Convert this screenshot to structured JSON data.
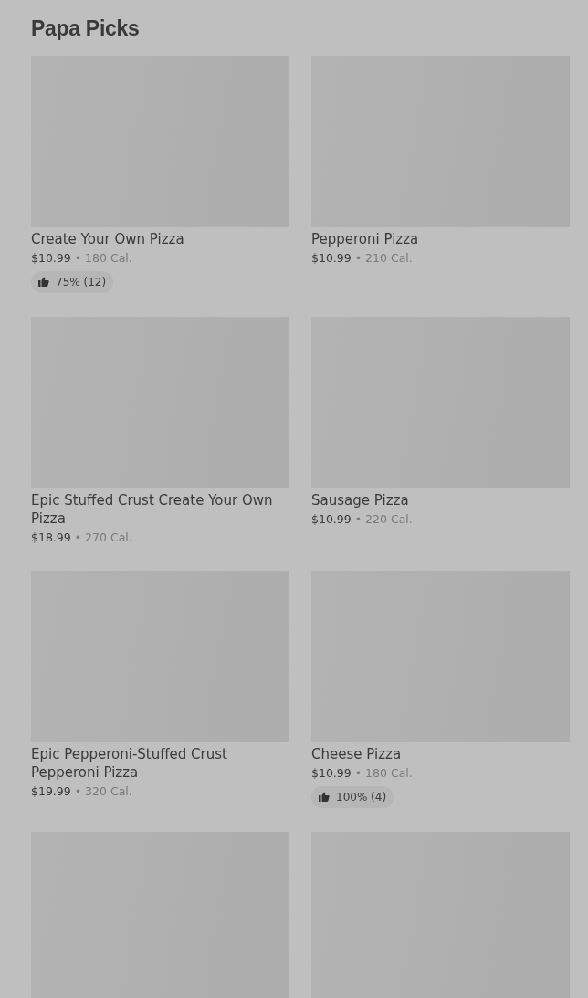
{
  "section": {
    "title": "Papa Picks"
  },
  "items": [
    {
      "kind": "product",
      "name": "Create Your Own Pizza",
      "price": "$10.99",
      "separator": "•",
      "calories": "180 Cal.",
      "rating": "75% (12)"
    },
    {
      "kind": "product",
      "name": "Pepperoni Pizza",
      "price": "$10.99",
      "separator": "•",
      "calories": "210 Cal."
    },
    {
      "kind": "product",
      "name": "Epic Stuffed Crust Create Your Own Pizza",
      "price": "$18.99",
      "separator": "•",
      "calories": "270 Cal."
    },
    {
      "kind": "product",
      "name": "Sausage Pizza",
      "price": "$10.99",
      "separator": "•",
      "calories": "220 Cal."
    },
    {
      "kind": "product",
      "name": "Epic Pepperoni-Stuffed Crust Pepperoni Pizza",
      "price": "$19.99",
      "separator": "•",
      "calories": "320 Cal."
    },
    {
      "kind": "product",
      "name": "Cheese Pizza",
      "price": "$10.99",
      "separator": "•",
      "calories": "180 Cal.",
      "rating": "100% (4)"
    },
    {
      "kind": "image-only"
    },
    {
      "kind": "image-only"
    }
  ]
}
